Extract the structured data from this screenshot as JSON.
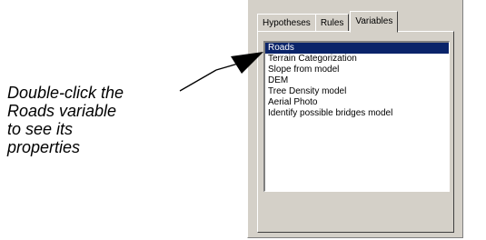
{
  "callout": {
    "lines": [
      "Double-click the",
      "Roads variable",
      "to see its",
      "properties"
    ]
  },
  "tabs": [
    {
      "label": "Hypotheses",
      "active": false
    },
    {
      "label": "Rules",
      "active": false
    },
    {
      "label": "Variables",
      "active": true
    }
  ],
  "variables": {
    "items": [
      "Roads",
      "Terrain Categorization",
      "Slope from model",
      "DEM",
      "Tree Density model",
      "Aerial Photo",
      "Identify possible bridges model"
    ],
    "selected": "Roads"
  },
  "colors": {
    "panel_bg": "#d4d0c8",
    "selection_bg": "#0a246a",
    "selection_fg": "#ffffff"
  },
  "icons": {
    "callout_arrow": "arrow-pointer-icon"
  }
}
